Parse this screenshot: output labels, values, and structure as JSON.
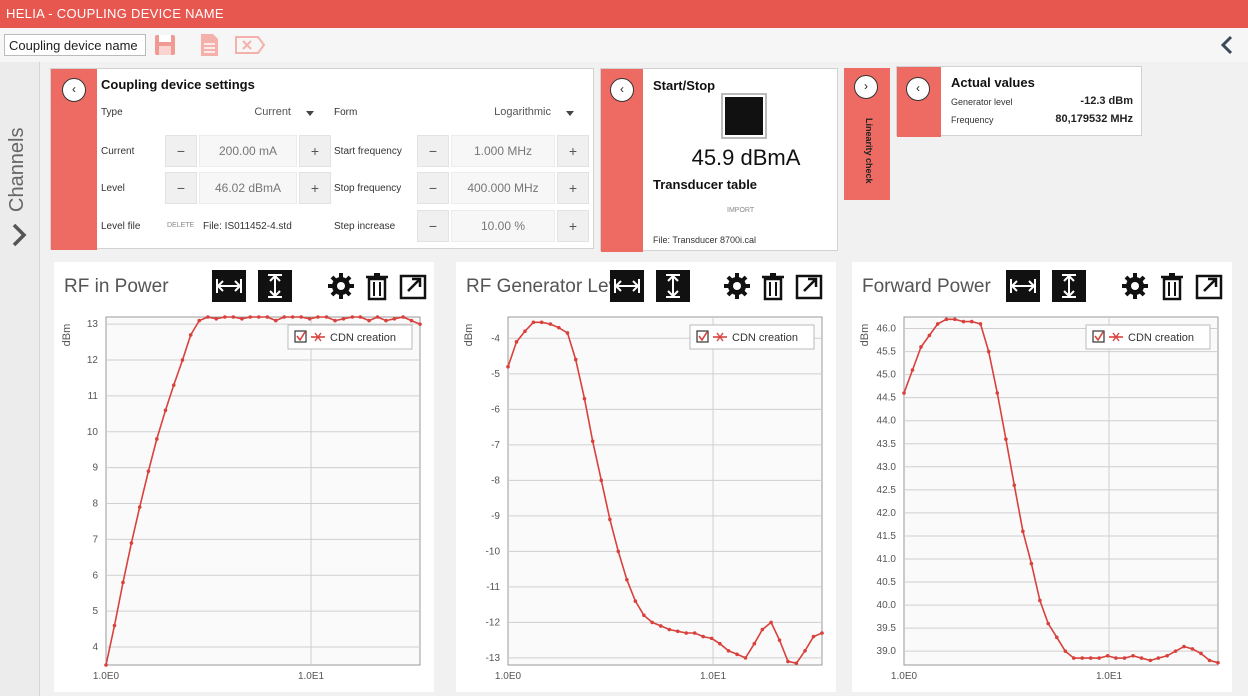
{
  "window": {
    "title": "HELIA - COUPLING DEVICE NAME"
  },
  "toolbar": {
    "device_name": "Coupling device name"
  },
  "sidebar": {
    "label": "Channels"
  },
  "coupling": {
    "title": "Coupling device settings",
    "type_label": "Type",
    "type_value": "Current",
    "form_label": "Form",
    "form_value": "Logarithmic",
    "current_label": "Current",
    "current_value": "200.00 mA",
    "level_label": "Level",
    "level_value": "46.02 dBmA",
    "levelfile_label": "Level file",
    "delete_label": "DELETE",
    "file_value": "File: IS011452-4.std",
    "start_label": "Start frequency",
    "start_value": "1.000 MHz",
    "stop_label": "Stop frequency",
    "stop_value": "400.000 MHz",
    "step_label": "Step increase",
    "step_value": "10.00 %",
    "minus": "−",
    "plus": "+",
    "collapse_glyph": "‹"
  },
  "startstop": {
    "title": "Start/Stop",
    "reading": "45.9 dBmA",
    "transducer_title": "Transducer table",
    "import_label": "IMPORT",
    "file": "File: Transducer 8700i.cal",
    "collapse_glyph": "‹"
  },
  "linearity": {
    "label": "Linearity check",
    "glyph": "›"
  },
  "actual": {
    "title": "Actual values",
    "gen_label": "Generator level",
    "gen_value": "-12.3 dBm",
    "freq_label": "Frequency",
    "freq_value": "80,179532 MHz",
    "collapse_glyph": "‹"
  },
  "colors": {
    "accent": "#e8574f",
    "strip": "#ee6b64",
    "series": "#d9413c"
  },
  "chart_data": [
    {
      "type": "line",
      "title": "RF in Power",
      "ylabel": "dBm",
      "xscale": "log",
      "x_ticks": [
        "1.0E0",
        "1.0E1"
      ],
      "y_ticks": [
        "4",
        "5",
        "6",
        "7",
        "8",
        "9",
        "10",
        "11",
        "12",
        "13"
      ],
      "ylim": [
        3.5,
        13.2
      ],
      "legend": "CDN creation",
      "series": [
        {
          "name": "CDN creation",
          "x": [
            1,
            1.1,
            1.21,
            1.33,
            1.46,
            1.61,
            1.77,
            1.95,
            2.14,
            2.36,
            2.59,
            2.85,
            3.14,
            3.45,
            3.8,
            4.18,
            4.6,
            5.05,
            5.56,
            6.12,
            6.73,
            7.4,
            8.14,
            8.95,
            9.85,
            10.8,
            11.9,
            13.1,
            14.4,
            15.9,
            17.4,
            19.2,
            21.1,
            23.2,
            25.5,
            28.1,
            30.9,
            34
          ],
          "y": [
            3.5,
            4.6,
            5.8,
            6.9,
            7.9,
            8.9,
            9.8,
            10.6,
            11.3,
            12,
            12.7,
            13.1,
            13.2,
            13.15,
            13.2,
            13.2,
            13.15,
            13.2,
            13.2,
            13.2,
            13.1,
            13.2,
            13.2,
            13.2,
            13.15,
            13.2,
            13.2,
            13.1,
            13.15,
            13.2,
            13.2,
            13.1,
            13.2,
            13.1,
            13.15,
            13.2,
            13.1,
            13.0
          ]
        }
      ]
    },
    {
      "type": "line",
      "title": "RF Generator Level",
      "ylabel": "dBm",
      "xscale": "log",
      "x_ticks": [
        "1.0E0",
        "1.0E1"
      ],
      "y_ticks": [
        "-4",
        "-5",
        "-6",
        "-7",
        "-8",
        "-9",
        "-10",
        "-11",
        "-12",
        "-13"
      ],
      "ylim": [
        -13.2,
        -3.4
      ],
      "legend": "CDN creation",
      "series": [
        {
          "name": "CDN creation",
          "x": [
            1,
            1.1,
            1.21,
            1.33,
            1.46,
            1.61,
            1.77,
            1.95,
            2.14,
            2.36,
            2.59,
            2.85,
            3.14,
            3.45,
            3.8,
            4.18,
            4.6,
            5.05,
            5.56,
            6.12,
            6.73,
            7.4,
            8.14,
            8.95,
            9.85,
            10.8,
            11.9,
            13.1,
            14.4,
            15.9,
            17.4,
            19.2,
            21.1,
            23.2,
            25.5,
            28.1,
            30.9,
            34
          ],
          "y": [
            -4.8,
            -4.1,
            -3.8,
            -3.55,
            -3.55,
            -3.6,
            -3.7,
            -3.85,
            -4.6,
            -5.7,
            -6.9,
            -8.0,
            -9.1,
            -10.0,
            -10.8,
            -11.4,
            -11.8,
            -12.0,
            -12.1,
            -12.2,
            -12.25,
            -12.3,
            -12.3,
            -12.4,
            -12.45,
            -12.6,
            -12.8,
            -12.9,
            -13.0,
            -12.6,
            -12.2,
            -12.0,
            -12.5,
            -13.1,
            -13.15,
            -12.8,
            -12.4,
            -12.3
          ]
        }
      ]
    },
    {
      "type": "line",
      "title": "Forward Power",
      "ylabel": "dBm",
      "xscale": "log",
      "x_ticks": [
        "1.0E0",
        "1.0E1"
      ],
      "y_ticks": [
        "39.0",
        "39.5",
        "40.0",
        "40.5",
        "41.0",
        "41.5",
        "42.0",
        "42.5",
        "43.0",
        "43.5",
        "44.0",
        "44.5",
        "45.0",
        "45.5",
        "46.0"
      ],
      "ylim": [
        38.7,
        46.25
      ],
      "legend": "CDN creation",
      "series": [
        {
          "name": "CDN creation",
          "x": [
            1,
            1.1,
            1.21,
            1.33,
            1.46,
            1.61,
            1.77,
            1.95,
            2.14,
            2.36,
            2.59,
            2.85,
            3.14,
            3.45,
            3.8,
            4.18,
            4.6,
            5.05,
            5.56,
            6.12,
            6.73,
            7.4,
            8.14,
            8.95,
            9.85,
            10.8,
            11.9,
            13.1,
            14.4,
            15.9,
            17.4,
            19.2,
            21.1,
            23.2,
            25.5,
            28.1,
            30.9,
            34
          ],
          "y": [
            44.6,
            45.1,
            45.6,
            45.85,
            46.1,
            46.2,
            46.2,
            46.15,
            46.15,
            46.1,
            45.5,
            44.6,
            43.6,
            42.6,
            41.6,
            40.9,
            40.1,
            39.6,
            39.3,
            39.0,
            38.85,
            38.85,
            38.85,
            38.85,
            38.9,
            38.85,
            38.85,
            38.9,
            38.85,
            38.8,
            38.85,
            38.9,
            39.0,
            39.1,
            39.05,
            38.95,
            38.8,
            38.75
          ]
        }
      ]
    }
  ]
}
